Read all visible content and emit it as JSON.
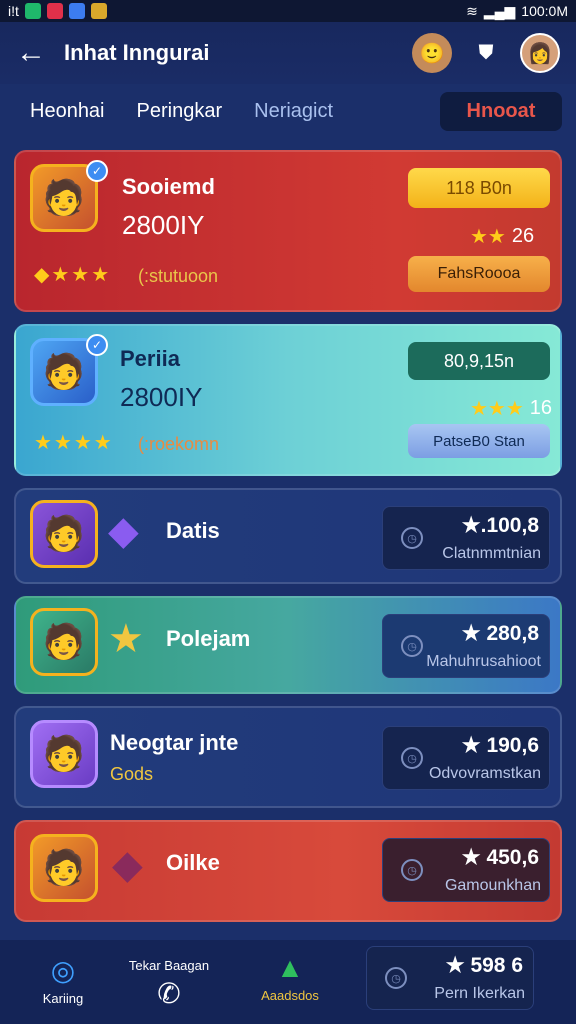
{
  "status": {
    "time": "100:0M",
    "left_text": "i!t"
  },
  "header": {
    "title": "Inhat Inngurai",
    "back_icon": "back-arrow-icon"
  },
  "tabs": [
    {
      "label": "Heonhai"
    },
    {
      "label": "Peringkar"
    },
    {
      "label": "Neriagict"
    },
    {
      "label": "Hnooat"
    }
  ],
  "cards": [
    {
      "name": "Sooiemd",
      "score": "2800IY",
      "pill_top": "118 B0n",
      "stars_count": "26",
      "sub": "(:stutuoon",
      "action": "FahsRoooa"
    },
    {
      "name": "Periia",
      "score": "2800IY",
      "pill_top": "80,9,15n",
      "stars_count": "16",
      "sub": "(:roekomn",
      "action": "PatseB0 Stan"
    },
    {
      "name": "Datis",
      "rank_score": "★.100,8",
      "rank_label": "Clatnmmtnian"
    },
    {
      "name": "Polejam",
      "rank_score": "★ 280,8",
      "rank_label": "Mahuhrusahioot"
    },
    {
      "name": "Neogtar jnte",
      "sub": "Gods",
      "rank_score": "★ 190,6",
      "rank_label": "Odvovramstkan"
    },
    {
      "name": "Oilke",
      "rank_score": "★ 450,6",
      "rank_label": "Gamounkhan"
    },
    {
      "rank_score": "★ 598 6",
      "rank_label": "Pern Ikerkan"
    }
  ],
  "bottom_nav": {
    "item1": "Kariing",
    "item2": "Tekar Baagan",
    "item3": "Aaadsdos"
  },
  "colors": {
    "accent_red": "#e8564b",
    "gold": "#ffcc1a",
    "bg": "#1b2f6a"
  }
}
